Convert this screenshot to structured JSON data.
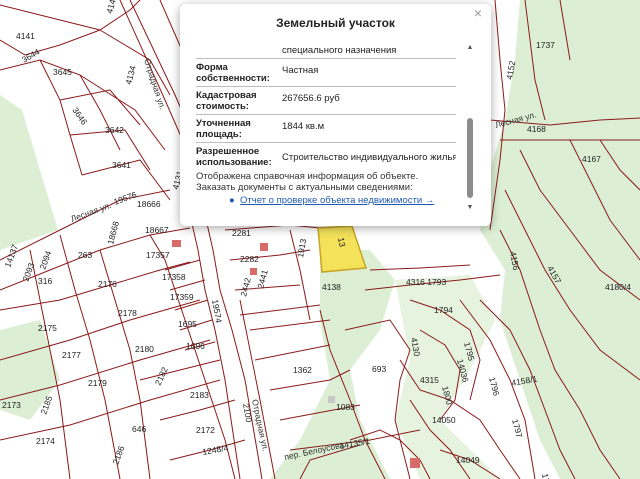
{
  "map": {
    "colors": {
      "parcel_line": "#8b1a1a",
      "green_area": "#dcefd4",
      "road": "#ffffff",
      "selected_parcel": "#f3e25a"
    },
    "plot_labels": [
      {
        "id": "p4141",
        "text": "4141"
      },
      {
        "id": "p4143",
        "text": "4143"
      },
      {
        "id": "p3644",
        "text": "3644"
      },
      {
        "id": "p3645",
        "text": "3645"
      },
      {
        "id": "p3646",
        "text": "3646"
      },
      {
        "id": "p3642",
        "text": "3642"
      },
      {
        "id": "p3641",
        "text": "3641"
      },
      {
        "id": "p4134",
        "text": "4134"
      },
      {
        "id": "p4131",
        "text": "4131"
      },
      {
        "id": "p18666",
        "text": "18666"
      },
      {
        "id": "p18668",
        "text": "18668"
      },
      {
        "id": "p18667",
        "text": "18667"
      },
      {
        "id": "p19576",
        "text": "19576"
      },
      {
        "id": "p14137",
        "text": "14137"
      },
      {
        "id": "p2094",
        "text": "2094"
      },
      {
        "id": "p2093",
        "text": "2093"
      },
      {
        "id": "p316",
        "text": "316"
      },
      {
        "id": "p263",
        "text": "263"
      },
      {
        "id": "p2176",
        "text": "2176"
      },
      {
        "id": "p17357",
        "text": "17357"
      },
      {
        "id": "p17358",
        "text": "17358"
      },
      {
        "id": "p17359",
        "text": "17359"
      },
      {
        "id": "p2175",
        "text": "2175"
      },
      {
        "id": "p2178",
        "text": "2178"
      },
      {
        "id": "p1695",
        "text": "1695"
      },
      {
        "id": "p1696",
        "text": "1696"
      },
      {
        "id": "p2177",
        "text": "2177"
      },
      {
        "id": "p2180",
        "text": "2180"
      },
      {
        "id": "p2179",
        "text": "2179"
      },
      {
        "id": "p2182",
        "text": "2182"
      },
      {
        "id": "p2183",
        "text": "2183"
      },
      {
        "id": "p2173",
        "text": "2173"
      },
      {
        "id": "p2185",
        "text": "2185"
      },
      {
        "id": "p646",
        "text": "646"
      },
      {
        "id": "p2174",
        "text": "2174"
      },
      {
        "id": "p2186",
        "text": "2186"
      },
      {
        "id": "p2172",
        "text": "2172"
      },
      {
        "id": "p19574",
        "text": "19574"
      },
      {
        "id": "p2281",
        "text": "2281"
      },
      {
        "id": "p2282",
        "text": "2282"
      },
      {
        "id": "p2442",
        "text": "2442"
      },
      {
        "id": "p2441",
        "text": "2441"
      },
      {
        "id": "p1913",
        "text": "1913"
      },
      {
        "id": "p4138",
        "text": "4138"
      },
      {
        "id": "p2100",
        "text": "2100"
      },
      {
        "id": "p1362",
        "text": "1362"
      },
      {
        "id": "p1083",
        "text": "1083"
      },
      {
        "id": "p1248_4",
        "text": "1248/4"
      },
      {
        "id": "p14135_1",
        "text": "14135/1"
      },
      {
        "id": "p693",
        "text": "693"
      },
      {
        "id": "p4316_1793",
        "text": "4316 1793"
      },
      {
        "id": "p4130",
        "text": "4130"
      },
      {
        "id": "p1794",
        "text": "1794"
      },
      {
        "id": "p1795",
        "text": "1795"
      },
      {
        "id": "p4315",
        "text": "4315"
      },
      {
        "id": "p14036",
        "text": "14036"
      },
      {
        "id": "p1800",
        "text": "1800"
      },
      {
        "id": "p14050",
        "text": "14050"
      },
      {
        "id": "p1796",
        "text": "1796"
      },
      {
        "id": "p14049",
        "text": "14049"
      },
      {
        "id": "p1797",
        "text": "1797"
      },
      {
        "id": "p4158_1",
        "text": "4158/1"
      },
      {
        "id": "p4157",
        "text": "4157"
      },
      {
        "id": "p4180_4",
        "text": "4180/4"
      },
      {
        "id": "p4156",
        "text": "4156"
      },
      {
        "id": "p4167",
        "text": "4167"
      },
      {
        "id": "p4168",
        "text": "4168"
      },
      {
        "id": "p4152",
        "text": "4152"
      },
      {
        "id": "p1737",
        "text": "1737"
      },
      {
        "id": "p1798",
        "text": "1798"
      },
      {
        "id": "p13",
        "text": "13"
      }
    ],
    "street_labels": [
      {
        "id": "s_otradnaya_top",
        "text": "Отрадная ул."
      },
      {
        "id": "s_lesnaya",
        "text": "Лесная ул."
      },
      {
        "id": "s_otradnaya_bottom",
        "text": "Отрадная ул."
      },
      {
        "id": "s_belousova",
        "text": "пер. Белоусова"
      },
      {
        "id": "s_lesnaya_right",
        "text": "Лесная ул."
      }
    ]
  },
  "popup": {
    "title": "Земельный участок",
    "close_glyph": "×",
    "partial_top_text": "специального назначения",
    "rows": [
      {
        "label": "Форма собственности:",
        "value": "Частная"
      },
      {
        "label": "Кадастровая стоимость:",
        "value": "267656.6 руб"
      },
      {
        "label": "Уточненная площадь:",
        "value": "1844 кв.м"
      },
      {
        "label": "Разрешенное использование:",
        "value": "Строительство индивидуального жилья"
      }
    ],
    "note_line1": "Отображена справочная информация об объекте.",
    "note_line2": "Заказать документы с актуальными сведениями:",
    "link_bullet": "●",
    "link_text": "Отчет о проверке объекта недвижимости →",
    "scroll_up": "▲",
    "scroll_down": "▼"
  }
}
